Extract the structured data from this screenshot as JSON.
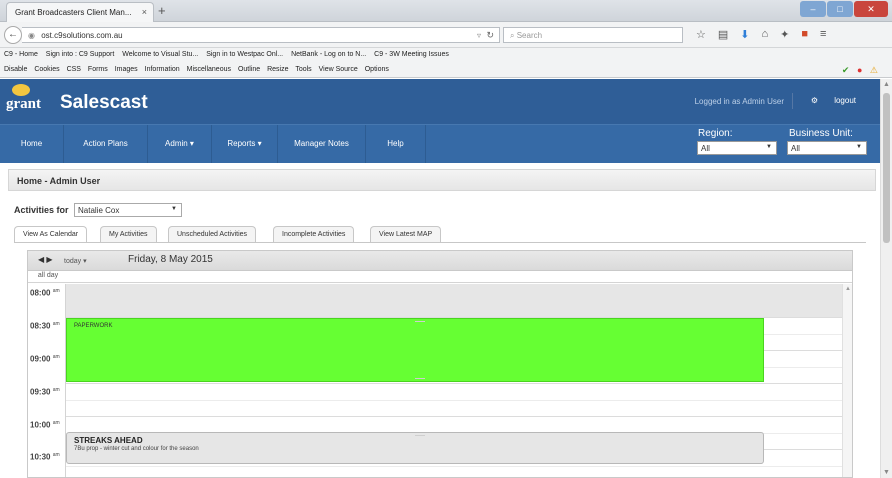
{
  "browser": {
    "tab_title": "Grant Broadcasters Client Man...",
    "tab_close": "×",
    "new_tab": "+",
    "url": "ost.c9solutions.com.au",
    "search_placeholder": "Search",
    "bookmarks": [
      "C9 - Home",
      "Sign into : C9 Support",
      "Welcome to Visual Stu...",
      "Sign in to Westpac Onl...",
      "NetBank - Log on to N...",
      "C9 - 3W Meeting Issues"
    ],
    "devbar": [
      "Disable",
      "Cookies",
      "CSS",
      "Forms",
      "Images",
      "Information",
      "Miscellaneous",
      "Outline",
      "Resize",
      "Tools",
      "View Source",
      "Options"
    ]
  },
  "app": {
    "logo_text": "grant",
    "title": "Salescast",
    "logged_in": "Logged in as Admin User",
    "logout": "logout",
    "nav": [
      "Home",
      "Action Plans",
      "Admin ▾",
      "Reports ▾",
      "Manager Notes",
      "Help"
    ],
    "region_label": "Region:",
    "region_value": "All",
    "business_unit_label": "Business Unit:",
    "business_unit_value": "All",
    "breadcrumb": "Home - Admin User",
    "activities_for_label": "Activities for",
    "activities_for_value": "Natalie Cox",
    "tabs": [
      "View As Calendar",
      "My Activities",
      "Unscheduled Activities",
      "Incomplete Activities",
      "View Latest MAP"
    ]
  },
  "calendar": {
    "today_label": "today",
    "date_title": "Friday, 8 May 2015",
    "all_day_label": "all day",
    "slots": [
      {
        "time": "08:00",
        "ampm": "am"
      },
      {
        "time": "08:30",
        "ampm": "am"
      },
      {
        "time": "09:00",
        "ampm": "am"
      },
      {
        "time": "09:30",
        "ampm": "am"
      },
      {
        "time": "10:00",
        "ampm": "am"
      },
      {
        "time": "10:30",
        "ampm": "am"
      }
    ],
    "events": [
      {
        "title": "PAPERWORK",
        "subtitle": "",
        "color": "#66ff33"
      },
      {
        "title": "STREAKS AHEAD",
        "subtitle": "7Bu prop - winter cut and colour for the season",
        "color": "#e6e6e6"
      }
    ]
  }
}
